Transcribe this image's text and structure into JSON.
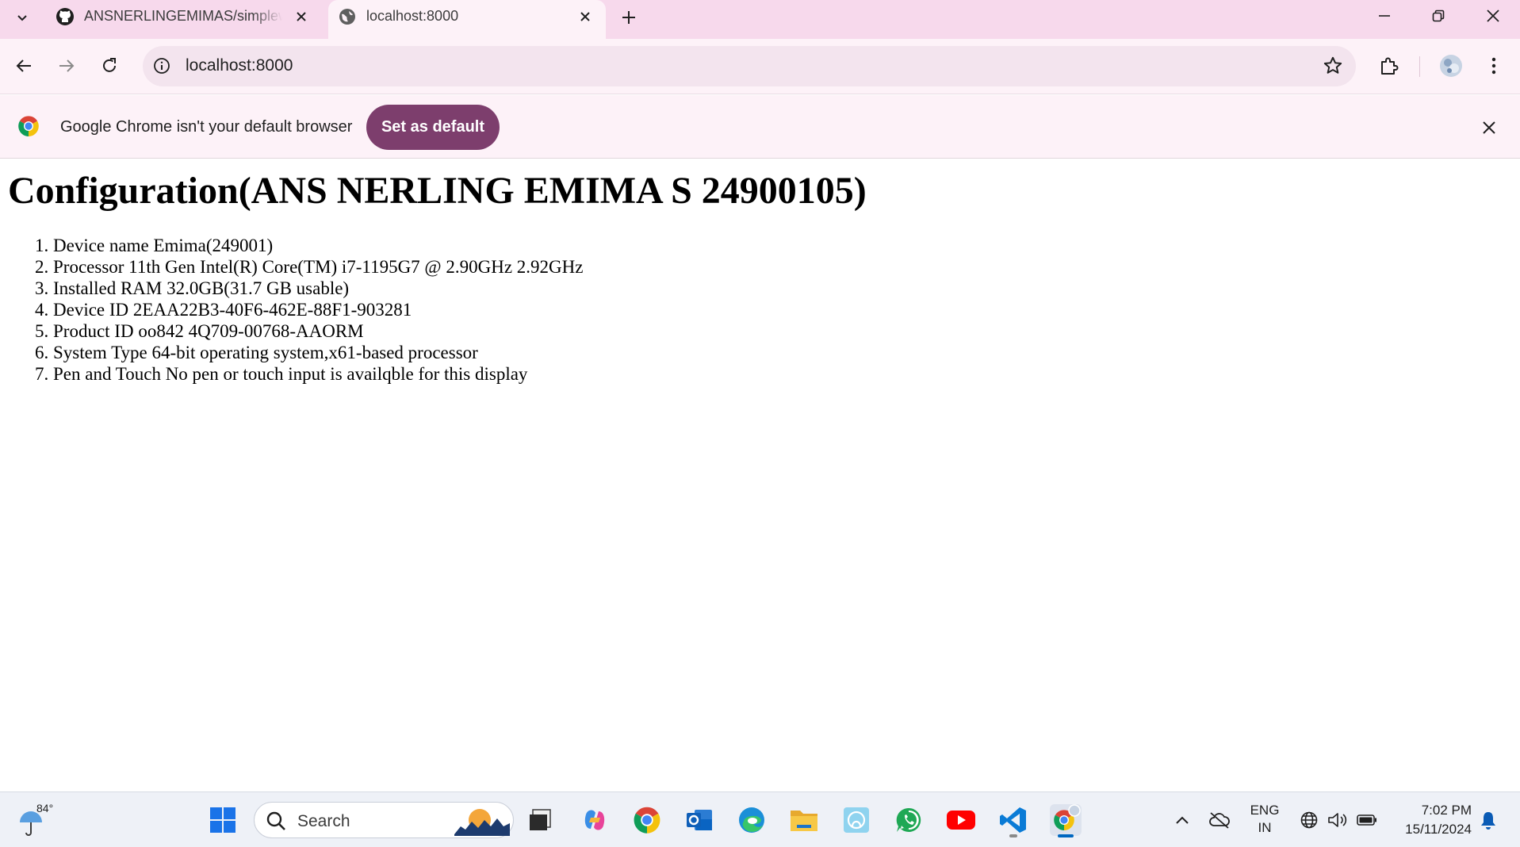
{
  "browser": {
    "tabs": [
      {
        "title": "ANSNERLINGEMIMAS/simpleweb",
        "favicon": "github-icon",
        "active": false
      },
      {
        "title": "localhost:8000",
        "favicon": "globe-icon",
        "active": true
      }
    ],
    "address": "localhost:8000",
    "infobar": {
      "message": "Google Chrome isn't your default browser",
      "button_label": "Set as default"
    }
  },
  "page": {
    "heading": "Configuration(ANS NERLING EMIMA S 24900105)",
    "items": [
      "1. Device name Emima(249001)",
      "2. Processor 11th Gen Intel(R) Core(TM) i7-1195G7 @ 2.90GHz 2.92GHz",
      "3. Installed RAM 32.0GB(31.7 GB usable)",
      "4. Device ID 2EAA22B3-40F6-462E-88F1-903281",
      "5. Product ID oo842 4Q709-00768-AAORM",
      "6. System Type 64-bit operating system,x61-based processor",
      "7. Pen and Touch No pen or touch input is availqble for this display"
    ]
  },
  "taskbar": {
    "weather_temp": "84°",
    "search_placeholder": "Search",
    "apps": [
      "windows-start-icon",
      "file-explorer-icon",
      "copilot-icon",
      "chrome-icon",
      "outlook-icon",
      "edge-icon",
      "folder-icon",
      "photos-icon",
      "whatsapp-icon",
      "youtube-icon",
      "vscode-icon",
      "chrome-profile-icon"
    ],
    "lang_top": "ENG",
    "lang_bottom": "IN",
    "time": "7:02 PM",
    "date": "15/11/2024"
  },
  "colors": {
    "tabstrip_bg": "#f7d9ec",
    "toolbar_bg": "#fdf2f8",
    "set_default_button": "#7d3e6d"
  }
}
